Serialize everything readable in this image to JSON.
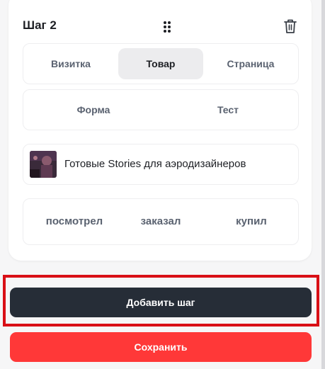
{
  "step": {
    "title": "Шаг 2",
    "drag_icon": "drag-handle-icon",
    "delete_icon": "trash-icon"
  },
  "tabs": [
    {
      "label": "Визитка",
      "active": false
    },
    {
      "label": "Товар",
      "active": true
    },
    {
      "label": "Страница",
      "active": false
    }
  ],
  "types": [
    {
      "label": "Форма"
    },
    {
      "label": "Тест"
    }
  ],
  "product": {
    "name": "Готовые Stories для аэродизайнеров",
    "thumbnail_icon": "product-thumbnail"
  },
  "statuses": [
    {
      "label": "посмотрел"
    },
    {
      "label": "заказал"
    },
    {
      "label": "купил"
    }
  ],
  "actions": {
    "add_step_label": "Добавить шаг",
    "save_label": "Сохранить"
  },
  "colors": {
    "primary_dark": "#262d37",
    "save_red": "#ff3838",
    "highlight_red": "#d90f16",
    "active_tab_bg": "#ececee"
  }
}
